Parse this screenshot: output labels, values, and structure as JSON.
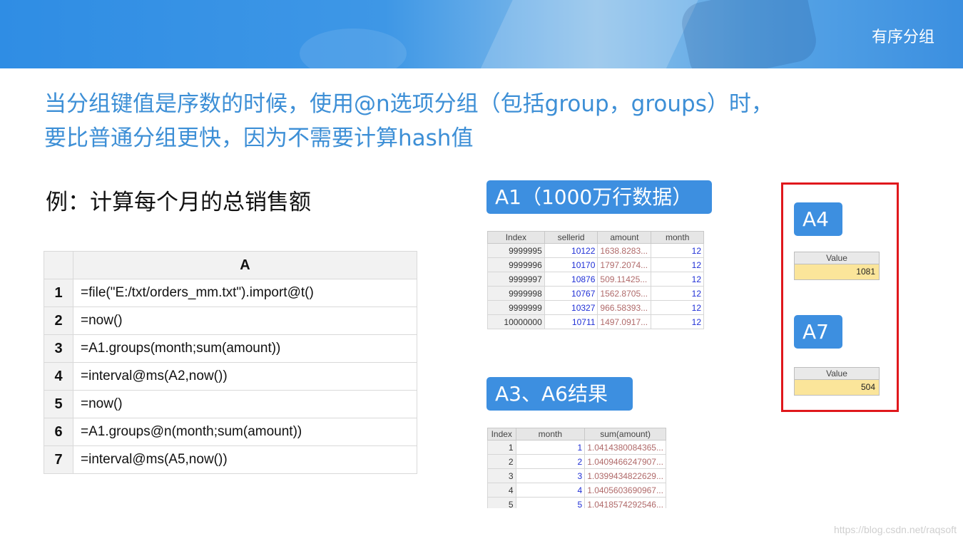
{
  "header": {
    "title": "有序分组"
  },
  "description": {
    "line1": "当分组键值是序数的时候，使用@n选项分组（包括group，groups）时，",
    "line2": "要比普通分组更快，因为不需要计算hash值"
  },
  "example_title": "例：计算每个月的总销售额",
  "grid": {
    "column_header": "A",
    "rows": [
      {
        "num": "1",
        "formula": "=file(\"E:/txt/orders_mm.txt\").import@t()"
      },
      {
        "num": "2",
        "formula": "=now()"
      },
      {
        "num": "3",
        "formula": "=A1.groups(month;sum(amount))"
      },
      {
        "num": "4",
        "formula": "=interval@ms(A2,now())"
      },
      {
        "num": "5",
        "formula": "=now()"
      },
      {
        "num": "6",
        "formula": "=A1.groups@n(month;sum(amount))"
      },
      {
        "num": "7",
        "formula": "=interval@ms(A5,now())"
      }
    ]
  },
  "labels": {
    "a1": "A1（1000万行数据）",
    "a3": "A3、A6结果",
    "a4": "A4",
    "a7": "A7"
  },
  "table_a1": {
    "headers": [
      "Index",
      "sellerid",
      "amount",
      "month"
    ],
    "rows": [
      [
        "9999995",
        "10122",
        "1638.8283...",
        "12"
      ],
      [
        "9999996",
        "10170",
        "1797.2074...",
        "12"
      ],
      [
        "9999997",
        "10876",
        "509.11425...",
        "12"
      ],
      [
        "9999998",
        "10767",
        "1562.8705...",
        "12"
      ],
      [
        "9999999",
        "10327",
        "966.58393...",
        "12"
      ],
      [
        "10000000",
        "10711",
        "1497.0917...",
        "12"
      ]
    ]
  },
  "table_a3": {
    "headers": [
      "Index",
      "month",
      "sum(amount)"
    ],
    "rows": [
      [
        "1",
        "1",
        "1.0414380084365..."
      ],
      [
        "2",
        "2",
        "1.0409466247907..."
      ],
      [
        "3",
        "3",
        "1.0399434822629..."
      ],
      [
        "4",
        "4",
        "1.0405603690967..."
      ],
      [
        "5",
        "5",
        "1.0418574292546..."
      ]
    ]
  },
  "value_a4": {
    "header": "Value",
    "value": "1081"
  },
  "value_a7": {
    "header": "Value",
    "value": "504"
  },
  "watermark": "https://blog.csdn.net/raqsoft"
}
